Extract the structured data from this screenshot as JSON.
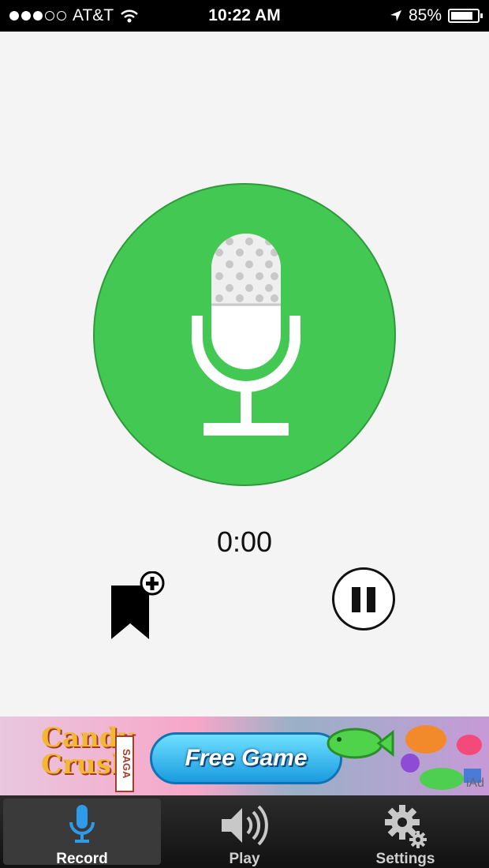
{
  "status_bar": {
    "carrier": "AT&T",
    "time": "10:22 AM",
    "battery_text": "85%",
    "battery_level": 0.85,
    "signal_bars_filled": 3,
    "signal_bars_total": 5
  },
  "recorder": {
    "elapsed": "0:00"
  },
  "ad": {
    "logo_line1": "Candy",
    "logo_line2": "Crush",
    "logo_tag": "SAGA",
    "cta": "Free Game",
    "provider": "iAd"
  },
  "tabs": [
    {
      "label": "Record",
      "icon": "microphone-icon",
      "active": true
    },
    {
      "label": "Play",
      "icon": "speaker-icon",
      "active": false
    },
    {
      "label": "Settings",
      "icon": "gear-icon",
      "active": false
    }
  ],
  "colors": {
    "record_green": "#43c853",
    "tab_highlight": "#3a3a3a",
    "mic_blue": "#2d9be8"
  }
}
